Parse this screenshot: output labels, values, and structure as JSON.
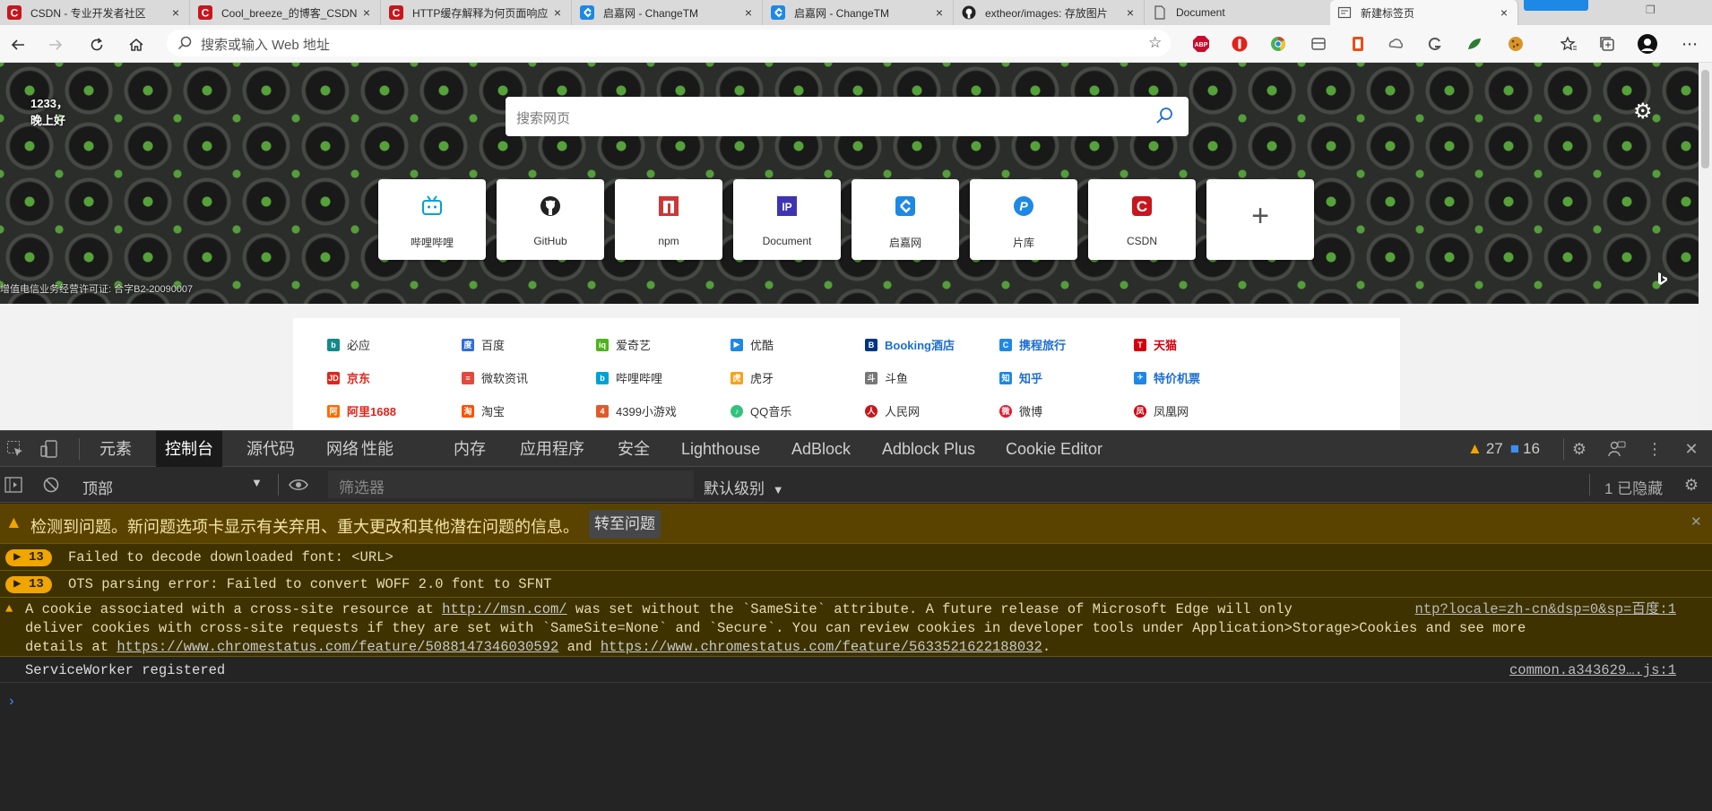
{
  "tabs": [
    {
      "title": "CSDN - 专业开发者社区",
      "icon": "csdn-icon",
      "color": "#c8161d"
    },
    {
      "title": "Cool_breeze_的博客_CSDN",
      "icon": "csdn-icon",
      "color": "#c8161d"
    },
    {
      "title": "HTTP缓存解释为何页面响应",
      "icon": "csdn-icon",
      "color": "#c8161d"
    },
    {
      "title": "启嘉网 - ChangeTM",
      "icon": "changetm-icon",
      "color": "#1e88e5"
    },
    {
      "title": "启嘉网 - ChangeTM",
      "icon": "changetm-icon",
      "color": "#1e88e5"
    },
    {
      "title": "extheor/images: 存放图片",
      "icon": "github-icon",
      "color": "#222222"
    },
    {
      "title": "Document",
      "icon": "document-icon",
      "color": "#555555"
    },
    {
      "title": "新建标签页",
      "icon": "newtab-icon",
      "color": "#555555"
    }
  ],
  "address": {
    "placeholder": "搜索或输入 Web 地址"
  },
  "newtab": {
    "greeting_line1": "1233，",
    "greeting_line2": "晚上好",
    "search_placeholder": "搜索网页",
    "icp": "增值电信业务经营许可证: 合字B2-20090007",
    "tiles": [
      {
        "label": "哔哩哔哩",
        "icon": "bilibili-icon",
        "color": "#00a1d6"
      },
      {
        "label": "GitHub",
        "icon": "github-icon",
        "color": "#222222"
      },
      {
        "label": "npm",
        "icon": "npm-icon",
        "color": "#cb3837"
      },
      {
        "label": "Document",
        "icon": "document-ip-icon",
        "color": "#3f33b4"
      },
      {
        "label": "启嘉网",
        "icon": "changetm-icon",
        "color": "#1e88e5"
      },
      {
        "label": "片库",
        "icon": "pianku-icon",
        "color": "#1e88e5"
      },
      {
        "label": "CSDN",
        "icon": "csdn-icon",
        "color": "#c8161d"
      },
      {
        "label": "+",
        "icon": "add-icon",
        "color": "#555555"
      }
    ],
    "links": [
      [
        {
          "label": "必应",
          "icon": "bing-icon",
          "color": "#138a8a",
          "style": "normal"
        },
        {
          "label": "百度",
          "icon": "baidu-icon",
          "color": "#2f6edb",
          "style": "normal"
        },
        {
          "label": "爱奇艺",
          "icon": "iqiyi-icon",
          "color": "#4eb31b",
          "style": "normal"
        },
        {
          "label": "优酷",
          "icon": "youku-icon",
          "color": "#1e88e5",
          "style": "normal"
        },
        {
          "label": "Booking酒店",
          "icon": "booking-icon",
          "color": "#003580",
          "style": "blue"
        },
        {
          "label": "携程旅行",
          "icon": "ctrip-icon",
          "color": "#1e88e5",
          "style": "blue"
        },
        {
          "label": "天猫",
          "icon": "tmall-icon",
          "color": "#d6000f",
          "style": "red"
        }
      ],
      [
        {
          "label": "京东",
          "icon": "jd-icon",
          "color": "#e1251b",
          "style": "red"
        },
        {
          "label": "微软资讯",
          "icon": "msn-icon",
          "color": "#e04a3f",
          "style": "normal"
        },
        {
          "label": "哔哩哔哩",
          "icon": "bilibili-icon",
          "color": "#00a1d6",
          "style": "normal"
        },
        {
          "label": "虎牙",
          "icon": "huya-icon",
          "color": "#f7a21b",
          "style": "normal"
        },
        {
          "label": "斗鱼",
          "icon": "douyu-icon",
          "color": "#777777",
          "style": "normal"
        },
        {
          "label": "知乎",
          "icon": "zhihu-icon",
          "color": "#1e88e5",
          "style": "blue"
        },
        {
          "label": "特价机票",
          "icon": "flight-icon",
          "color": "#1e88e5",
          "style": "blue"
        }
      ],
      [
        {
          "label": "阿里1688",
          "icon": "alibaba-icon",
          "color": "#ff6a00",
          "style": "red"
        },
        {
          "label": "淘宝",
          "icon": "taobao-icon",
          "color": "#ff5000",
          "style": "normal"
        },
        {
          "label": "4399小游戏",
          "icon": "4399-icon",
          "color": "#e05a2a",
          "style": "normal"
        },
        {
          "label": "QQ音乐",
          "icon": "qqmusic-icon",
          "color": "#31c27c",
          "style": "normal"
        },
        {
          "label": "人民网",
          "icon": "people-icon",
          "color": "#c8161d",
          "style": "normal"
        },
        {
          "label": "微博",
          "icon": "weibo-icon",
          "color": "#e6162d",
          "style": "normal"
        },
        {
          "label": "凤凰网",
          "icon": "ifeng-icon",
          "color": "#d6000f",
          "style": "normal"
        }
      ]
    ]
  },
  "devtools": {
    "tabs": [
      "元素",
      "控制台",
      "源代码",
      "网络",
      "性能",
      "内存",
      "应用程序",
      "安全",
      "Lighthouse",
      "AdBlock",
      "Adblock Plus",
      "Cookie Editor"
    ],
    "active_tab": "控制台",
    "warnings_count": "27",
    "messages_count": "16",
    "context": "顶部",
    "filter_placeholder": "筛选器",
    "level": "默认级别",
    "hidden": "1 已隐藏",
    "issues_text": "检测到问题。新问题选项卡显示有关弃用、重大更改和其他潜在问题的信息。",
    "issues_button": "转至问题",
    "console": {
      "msg1_count": "13",
      "msg1": "Failed to decode downloaded font: <URL>",
      "msg2_count": "13",
      "msg2": "OTS parsing error: Failed to convert WOFF 2.0 font to SFNT",
      "msg3_part1": "A cookie associated with a cross-site resource at ",
      "msg3_link1": "http://msn.com/",
      "msg3_part2": " was set without the `SameSite` attribute. A future release of Microsoft Edge will only",
      "msg3_source": "ntp?locale=zh-cn&dsp=0&sp=百度:1",
      "msg3_line2": "deliver cookies with cross-site requests if they are set with `SameSite=None` and `Secure`. You can review cookies in developer tools under Application>Storage>Cookies and see more",
      "msg3_part3": "details at ",
      "msg3_link2": "https://www.chromestatus.com/feature/5088147346030592",
      "msg3_and": " and ",
      "msg3_link3": "https://www.chromestatus.com/feature/5633521622188032",
      "msg3_end": ".",
      "msg4": "ServiceWorker registered",
      "msg4_source": "common.a343629….js:1"
    }
  }
}
